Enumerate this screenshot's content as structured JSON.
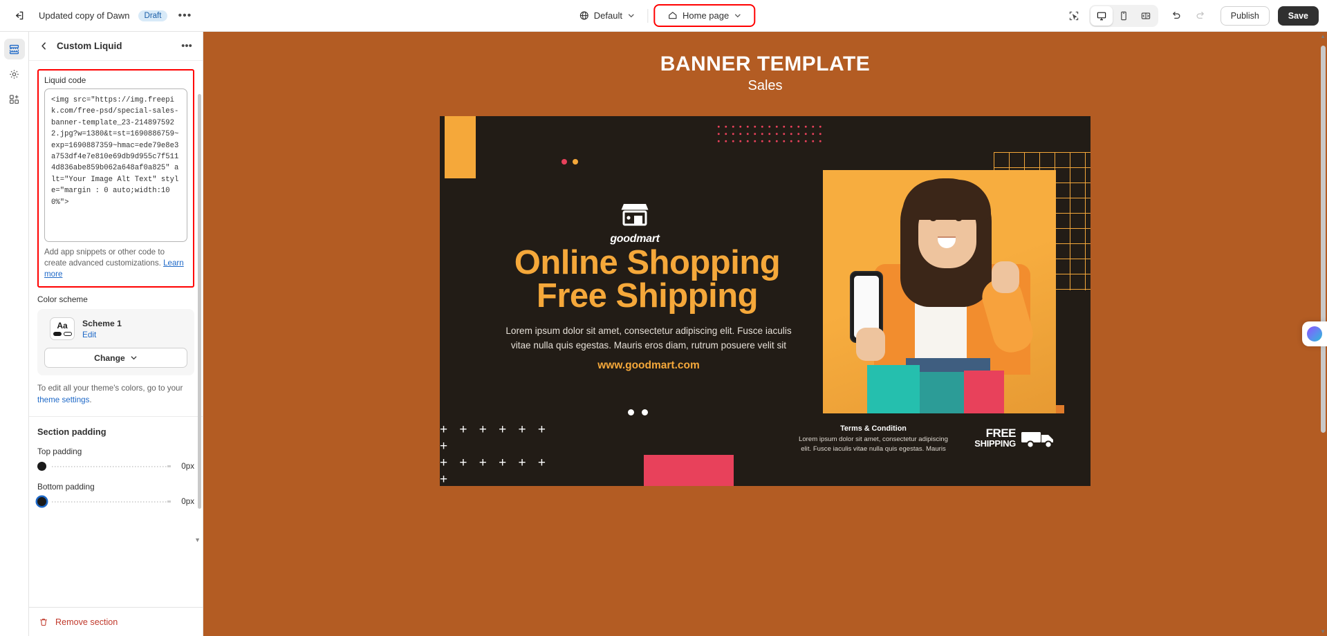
{
  "topbar": {
    "exit_icon": "exit-icon",
    "theme_name": "Updated copy of Dawn",
    "draft_badge": "Draft",
    "more_icon": "ellipsis-icon",
    "locale_icon": "globe-icon",
    "locale_label": "Default",
    "page_icon": "home-icon",
    "page_label": "Home page",
    "inspect_icon": "inspector-icon",
    "desktop_icon": "desktop-icon",
    "mobile_icon": "mobile-icon",
    "fullwidth_icon": "fullscreen-icon",
    "undo_icon": "undo-icon",
    "redo_icon": "redo-icon",
    "publish_label": "Publish",
    "save_label": "Save",
    "highlight_color": "#ff0000"
  },
  "rail": {
    "items": [
      {
        "name": "sections-icon",
        "active": true
      },
      {
        "name": "settings-gear-icon",
        "active": false
      },
      {
        "name": "apps-add-icon",
        "active": false
      }
    ]
  },
  "sidebar": {
    "back_icon": "chevron-left-icon",
    "title": "Custom Liquid",
    "more_icon": "ellipsis-icon",
    "liquid": {
      "label": "Liquid code",
      "code": "<img src=\"https://img.freepik.com/free-psd/special-sales-banner-template_23-2148975922.jpg?w=1380&t=st=1690886759~exp=1690887359~hmac=ede79e8e3a753df4e7e810e69db9d955c7f5114d836abe859b062a648af0a825\" alt=\"Your Image Alt Text\" style=\"margin : 0 auto;width:100%\">",
      "help_text": "Add app snippets or other code to create advanced customizations. ",
      "help_link": "Learn more"
    },
    "color_scheme": {
      "label": "Color scheme",
      "swatch_text": "Aa",
      "name": "Scheme 1",
      "edit_label": "Edit",
      "change_label": "Change",
      "note_text": "To edit all your theme's colors, go to your ",
      "note_link": "theme settings",
      "note_tail": "."
    },
    "section_padding": {
      "title": "Section padding",
      "top_label": "Top padding",
      "top_value": "0px",
      "bottom_label": "Bottom padding",
      "bottom_value": "0px"
    },
    "footer": {
      "remove_icon": "trash-icon",
      "remove_label": "Remove section"
    }
  },
  "preview": {
    "canvas_bg": "#b35c23",
    "banner": {
      "title": "BANNER TEMPLATE",
      "subtitle": "Sales",
      "logo_icon": "storefront-icon",
      "logo_name": "goodmart",
      "headline_line1": "Online Shopping",
      "headline_line2": "Free Shipping",
      "body_line1": "Lorem ipsum dolor sit amet, consectetur adipiscing elit. Fusce iaculis",
      "body_line2": "vitae nulla quis egestas. Mauris eros diam, rutrum posuere velit sit",
      "url": "www.goodmart.com",
      "terms_title": "Terms & Condition",
      "terms_line1": "Lorem ipsum dolor sit amet, consectetur adipiscing",
      "terms_line2": "elit. Fusce iaculis vitae nulla quis egestas. Mauris",
      "free_line1": "FREE",
      "free_line2": "SHIPPING",
      "truck_icon": "delivery-truck-icon",
      "plus_rows": [
        "+ + + + + + +",
        "+ + + + + + +",
        "+ + + + + + +",
        "+ + + + + +"
      ],
      "accent_orange": "#f5a83a",
      "accent_pink": "#e8415b",
      "dark_bg": "#221c16"
    }
  },
  "ai_widget": {
    "icon": "ai-assistant-icon"
  }
}
